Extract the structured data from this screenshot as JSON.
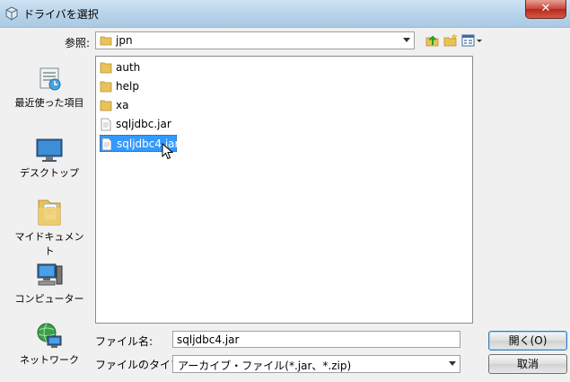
{
  "window": {
    "title": "ドライバを選択",
    "close_label": "✕"
  },
  "lookin": {
    "label": "参照:",
    "value": "jpn"
  },
  "places": [
    {
      "label": "最近使った項目",
      "icon": "recent-places-icon"
    },
    {
      "label": "デスクトップ",
      "icon": "desktop-icon"
    },
    {
      "label": "マイドキュメント",
      "icon": "documents-icon"
    },
    {
      "label": "コンピューター",
      "icon": "computer-icon"
    },
    {
      "label": "ネットワーク",
      "icon": "network-icon"
    }
  ],
  "files": [
    {
      "name": "auth",
      "type": "folder"
    },
    {
      "name": "help",
      "type": "folder"
    },
    {
      "name": "xa",
      "type": "folder"
    },
    {
      "name": "sqljdbc.jar",
      "type": "file"
    },
    {
      "name": "sqljdbc4.jar",
      "type": "file",
      "selected": true
    }
  ],
  "filename": {
    "label": "ファイル名:",
    "value": "sqljdbc4.jar"
  },
  "filetype": {
    "label": "ファイルのタイプ:",
    "value": "アーカイブ・ファイル(*.jar、*.zip)"
  },
  "buttons": {
    "open": "開く(O)",
    "cancel": "取消"
  },
  "colors": {
    "selection": "#3399ff",
    "titlebar": "#b7d3ea",
    "close": "#c7443a"
  }
}
